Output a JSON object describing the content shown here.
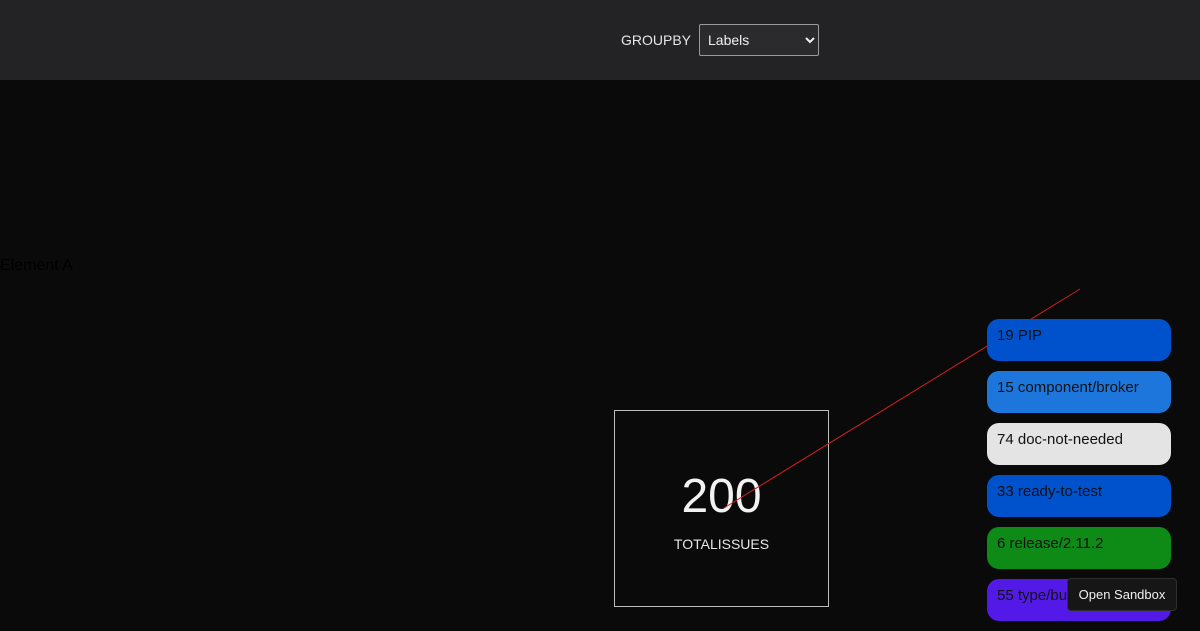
{
  "header": {
    "groupby_label": "GROUPBY",
    "groupby_selected": "Labels",
    "groupby_options": [
      "Labels"
    ]
  },
  "element_a": "Element A",
  "total": {
    "count": "200",
    "label": "TOTALISSUES"
  },
  "labels": [
    {
      "text": "19 PIP",
      "color": "#0052cc"
    },
    {
      "text": "15 component/broker",
      "color": "#1d76db"
    },
    {
      "text": "74 doc-not-needed",
      "color": "#e4e4e4"
    },
    {
      "text": "33 ready-to-test",
      "color": "#0052cc"
    },
    {
      "text": "6 release/2.11.2",
      "color": "#0e8a16"
    },
    {
      "text": "55 type/bug",
      "color": "#5319e7"
    }
  ],
  "sandbox_button": "Open Sandbox",
  "colors": {
    "header_bg": "#232326",
    "page_bg": "#0a0a0a",
    "connector_line": "#d01f1f"
  }
}
